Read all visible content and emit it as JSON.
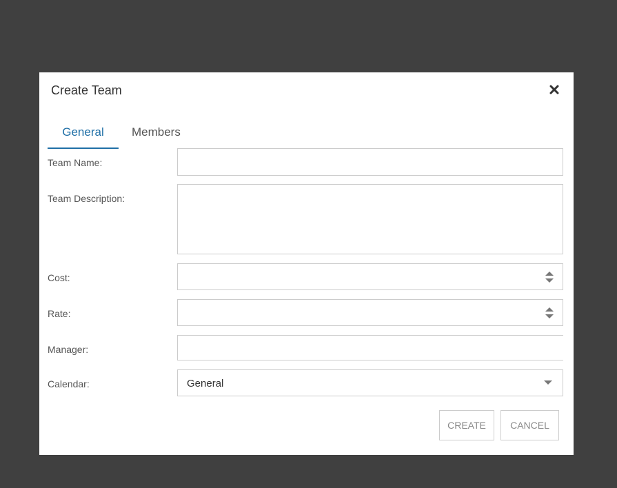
{
  "dialog": {
    "title": "Create Team",
    "close_icon": "close-icon"
  },
  "tabs": [
    {
      "label": "General",
      "active": true
    },
    {
      "label": "Members",
      "active": false
    }
  ],
  "form": {
    "team_name_label": "Team Name:",
    "team_name_value": "",
    "team_description_label": "Team Description:",
    "team_description_value": "",
    "cost_label": "Cost:",
    "cost_value": "",
    "rate_label": "Rate:",
    "rate_value": "",
    "manager_label": "Manager:",
    "manager_value": "",
    "calendar_label": "Calendar:",
    "calendar_value": "General"
  },
  "buttons": {
    "create_label": "CREATE",
    "cancel_label": "CANCEL"
  },
  "colors": {
    "overlay": "#404040",
    "accent": "#1f6fa6"
  }
}
